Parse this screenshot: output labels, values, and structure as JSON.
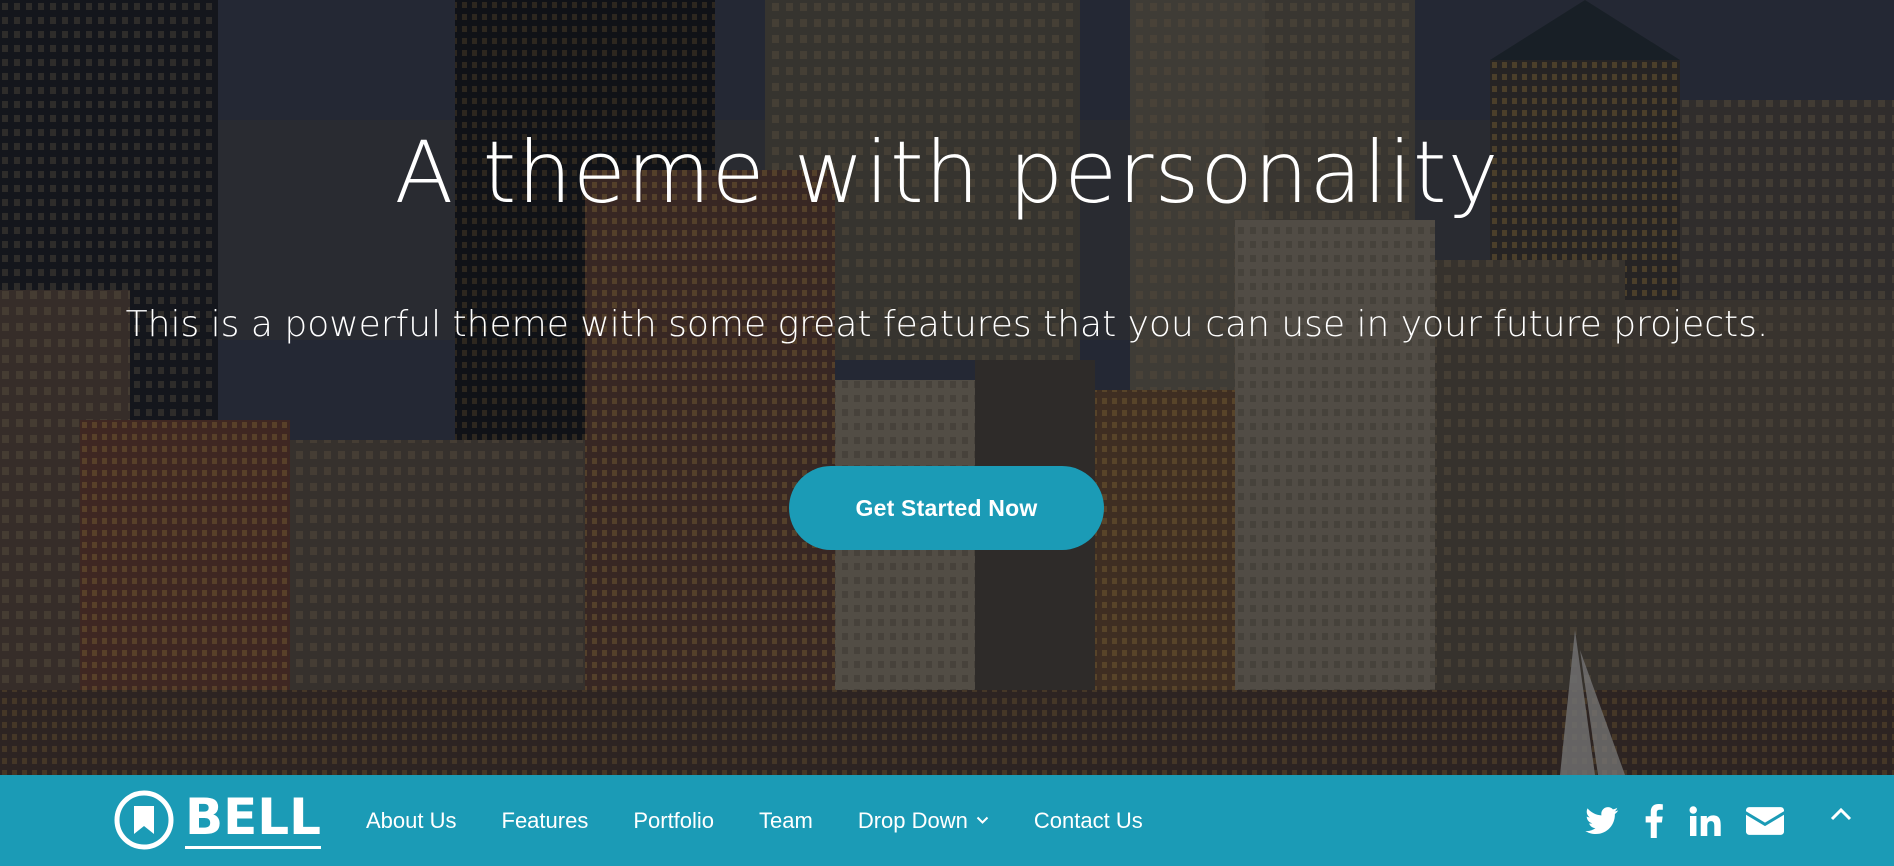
{
  "hero": {
    "title": "A theme with personality",
    "subtitle": "This is a powerful theme with some great features that you can use in your future projects.",
    "cta_label": "Get Started Now"
  },
  "navbar": {
    "brand": "BELL",
    "links": [
      {
        "label": "About Us"
      },
      {
        "label": "Features"
      },
      {
        "label": "Portfolio"
      },
      {
        "label": "Team"
      },
      {
        "label": "Drop Down",
        "has_dropdown": true
      },
      {
        "label": "Contact Us"
      }
    ],
    "social_icons": [
      "twitter-icon",
      "facebook-icon",
      "linkedin-icon",
      "envelope-icon"
    ],
    "scroll_top_icon": "chevron-up-icon"
  },
  "colors": {
    "accent": "#1b9bb6",
    "text_light": "#ffffff"
  }
}
